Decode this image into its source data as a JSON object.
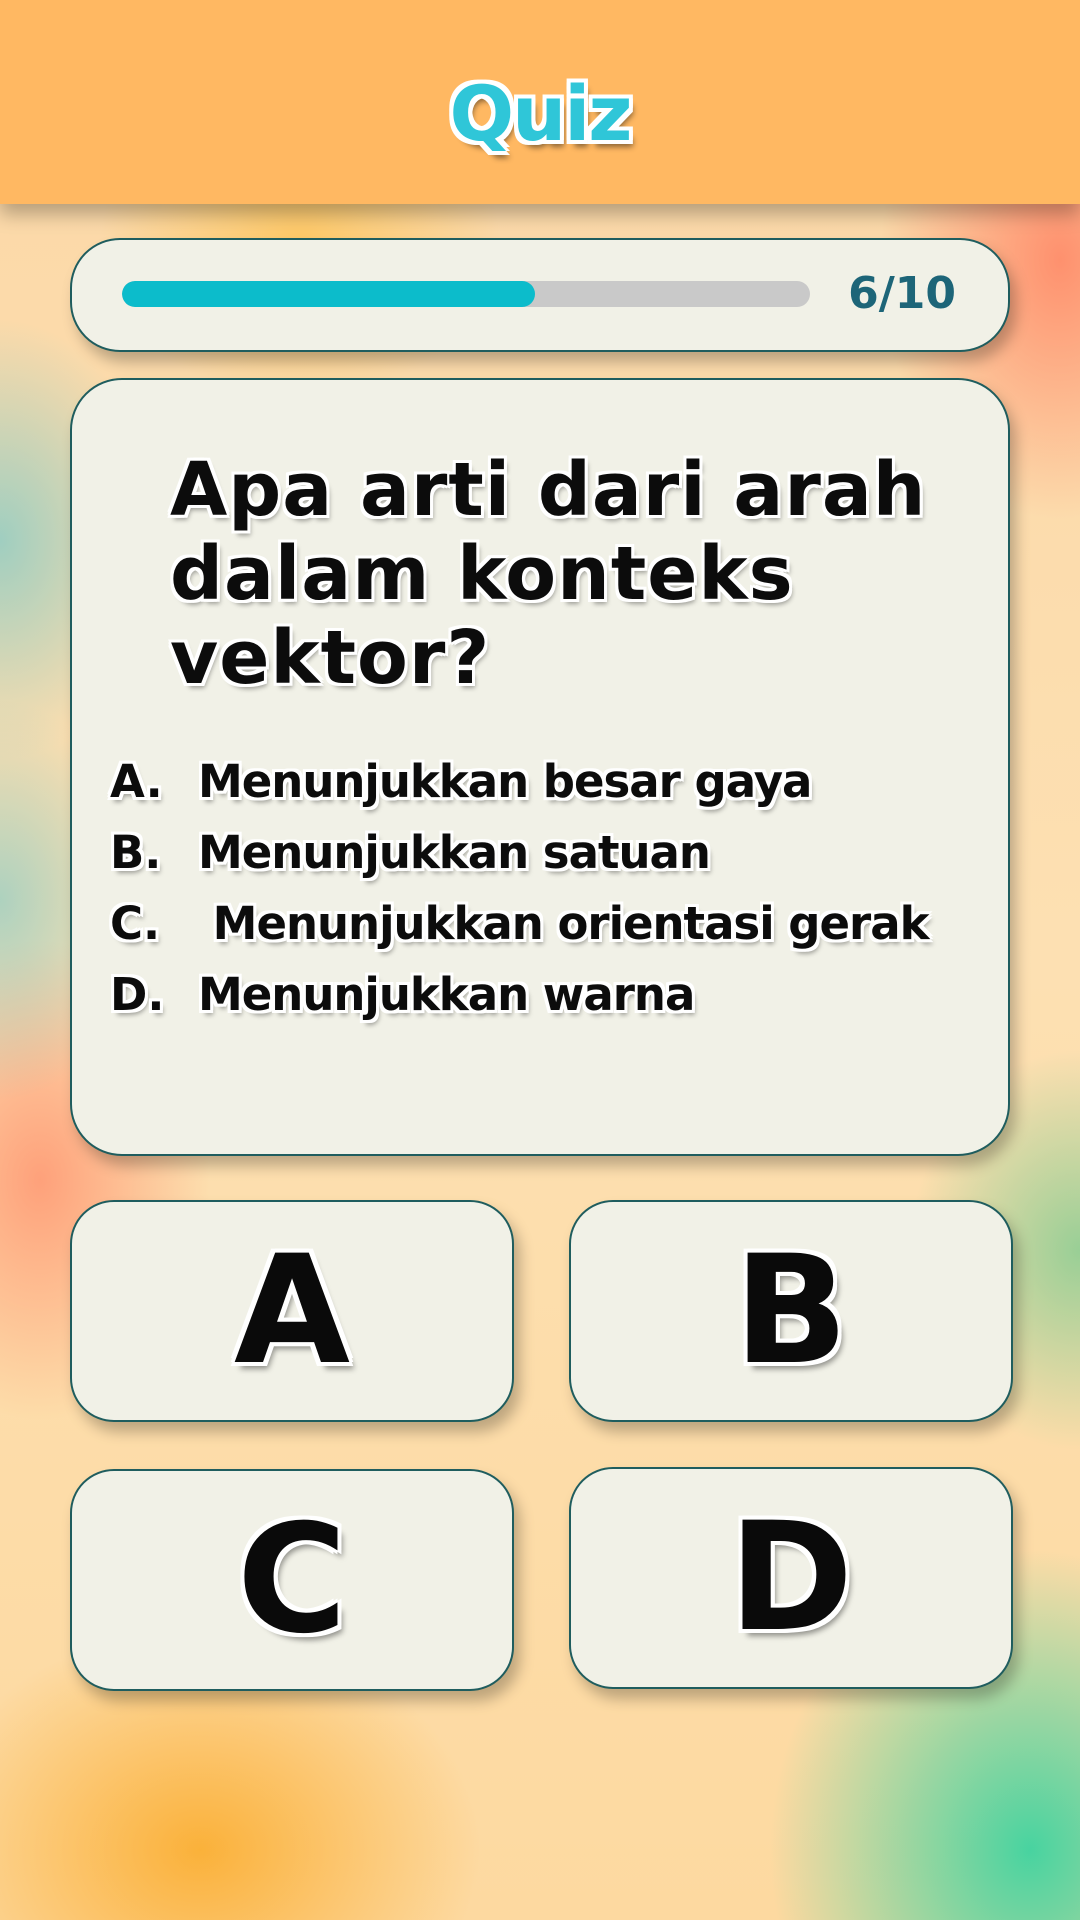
{
  "header": {
    "title": "Quiz",
    "title_color": "#2fc6d8",
    "background_color": "#ffb862"
  },
  "progress": {
    "label": "6/10",
    "current": 6,
    "total": 10,
    "fill_fraction": 0.6,
    "fill_color": "#0cbccb"
  },
  "question": {
    "text": "Apa arti dari arah dalam konteks vektor?",
    "options": [
      {
        "letter": "A.",
        "text": "Menunjukkan besar gaya"
      },
      {
        "letter": "B.",
        "text": "Menunjukkan satuan"
      },
      {
        "letter": "C.",
        "text": " Menunjukkan orientasi gerak"
      },
      {
        "letter": "D.",
        "text": "Menunjukkan warna"
      }
    ]
  },
  "answers": {
    "a": "A",
    "b": "B",
    "c": "C",
    "d": "D"
  }
}
